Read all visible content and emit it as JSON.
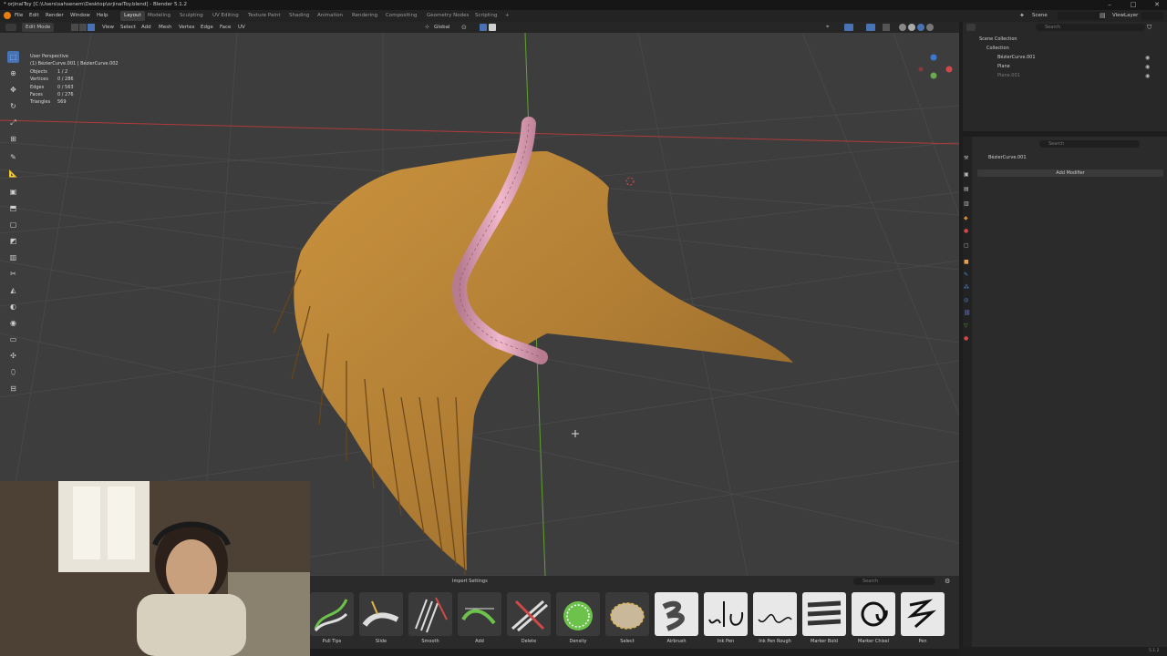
{
  "window": {
    "title": "* orjinalToy [C:\\Users\\sahsenem\\Desktop\\orjinalToy.blend] - Blender 5.1.2",
    "controls": [
      "–",
      "□",
      "✕"
    ]
  },
  "menubar": {
    "items": [
      "File",
      "Edit",
      "Render",
      "Window",
      "Help"
    ],
    "workspaces": [
      "Layout",
      "Modeling",
      "Sculpting",
      "UV Editing",
      "Texture Paint",
      "Shading",
      "Animation",
      "Rendering",
      "Compositing",
      "Geometry Nodes",
      "Scripting",
      "+"
    ],
    "active_workspace": "Layout",
    "scene_label": "Scene",
    "viewlayer_label": "ViewLayer"
  },
  "header3d": {
    "mode": "Edit Mode",
    "menus": [
      "View",
      "Select",
      "Add",
      "Mesh",
      "Vertex",
      "Edge",
      "Face",
      "UV"
    ],
    "orientation": "Global",
    "options": "Options"
  },
  "viewport": {
    "view_name": "User Perspective",
    "active_objects": "(1) BézierCurve.001 | BézierCurve.002",
    "stats": [
      {
        "label": "Objects",
        "value": "1 / 2"
      },
      {
        "label": "Vertices",
        "value": "0 / 286"
      },
      {
        "label": "Edges",
        "value": "0 / 563"
      },
      {
        "label": "Faces",
        "value": "0 / 276"
      },
      {
        "label": "Triangles",
        "value": "569"
      }
    ]
  },
  "outliner": {
    "search_placeholder": "Search",
    "scene_collection": "Scene Collection",
    "collection": "Collection",
    "objects": [
      "BézierCurve.001",
      "Plane",
      "Plane.001"
    ]
  },
  "properties": {
    "search_placeholder": "Search",
    "object_name": "BézierCurve.001",
    "add_modifier": "Add Modifier"
  },
  "assetbar": {
    "import_settings": "Import Settings",
    "search_placeholder": "Search",
    "brushes": [
      "Pull Tips",
      "Slide",
      "Smooth",
      "Add",
      "Delete",
      "Density",
      "Select",
      "Airbrush",
      "Ink Pen",
      "Ink Pen Rough",
      "Marker Bold",
      "Marker Chisel",
      "Pen"
    ]
  },
  "statusbar": {
    "version": "5.1.2"
  }
}
